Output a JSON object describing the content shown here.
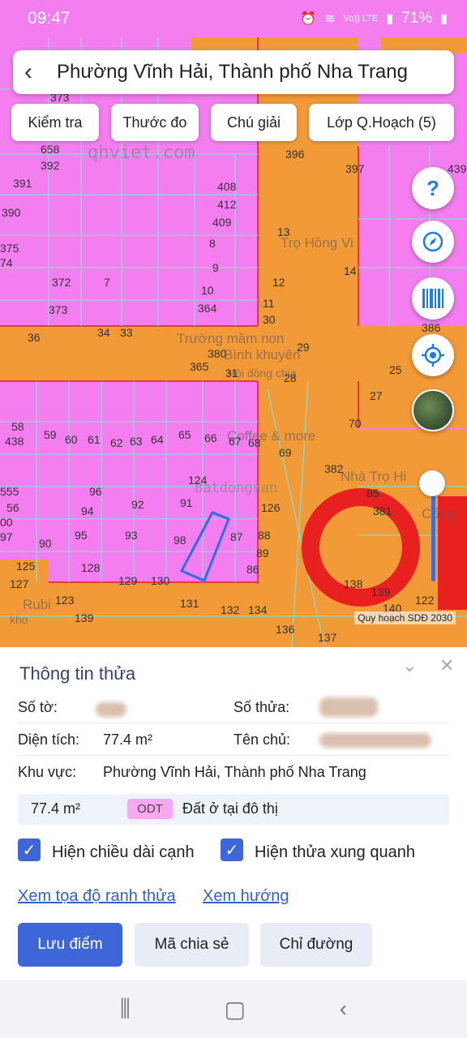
{
  "status_bar": {
    "time": "09:47",
    "battery": "71%",
    "net": "Vo)) LTE"
  },
  "header": {
    "title": "Phường Vĩnh Hải, Thành phố Nha Trang"
  },
  "toolbar": {
    "check": "Kiểm tra",
    "measure": "Thước đo",
    "legend": "Chú giải",
    "layers": "Lớp Q.Hoạch (5)"
  },
  "map": {
    "watermark_site": "qhviet.com",
    "watermark_brand": "Batdongsan",
    "footer": "Quy hoạch SDĐ 2030",
    "zone_letters": "OD",
    "pois": [
      "Trọ Hồng Vi",
      "Trường mầm non",
      "Bình khuyên",
      "Hội đồng chia",
      "Nhà Trọ Hi",
      "Cổng",
      "Rubi",
      "kho",
      "Coffee & more"
    ],
    "parcels": [
      "373",
      "658",
      "392",
      "391",
      "390",
      "375",
      "74",
      "372",
      "7",
      "373",
      "36",
      "34",
      "33",
      "408",
      "412",
      "409",
      "8",
      "9",
      "10",
      "364",
      "380",
      "365",
      "31",
      "13",
      "12",
      "11",
      "30",
      "29",
      "28",
      "396",
      "397",
      "439",
      "14",
      "386",
      "25",
      "27",
      "70",
      "58",
      "438",
      "59",
      "60",
      "61",
      "62",
      "63",
      "64",
      "65",
      "66",
      "67",
      "68",
      "69",
      "382",
      "85",
      "381",
      "555",
      "56",
      "00",
      "97",
      "96",
      "94",
      "92",
      "91",
      "124",
      "95",
      "93",
      "98",
      "90",
      "87",
      "88",
      "89",
      "86",
      "126",
      "128",
      "129",
      "130",
      "131",
      "132",
      "134",
      "136",
      "137",
      "138",
      "139",
      "140",
      "122",
      "125",
      "123",
      "127",
      "139"
    ]
  },
  "panel": {
    "title": "Thông tin thửa",
    "sheet_label": "Số tờ:",
    "parcel_label": "Số thửa:",
    "area_label": "Diện tích:",
    "area_value": "77.4 m²",
    "owner_label": "Tên chủ:",
    "region_label": "Khu vực:",
    "region_value": "Phường Vĩnh Hải, Thành phố Nha Trang",
    "land_area": "77.4 m²",
    "land_code": "ODT",
    "land_desc": "Đất ở tại đô thị",
    "show_edge_length": "Hiện chiều dài cạnh",
    "show_neighbors": "Hiện thửa xung quanh",
    "view_coords": "Xem tọa độ ranh thửa",
    "view_direction": "Xem hướng",
    "save": "Lưu điểm",
    "share": "Mã chia sẻ",
    "directions": "Chỉ đường"
  },
  "colors": {
    "residential": "#f47ef0",
    "road": "#f29a38",
    "accent": "#3d66d8",
    "zone_ring": "#e82020"
  }
}
